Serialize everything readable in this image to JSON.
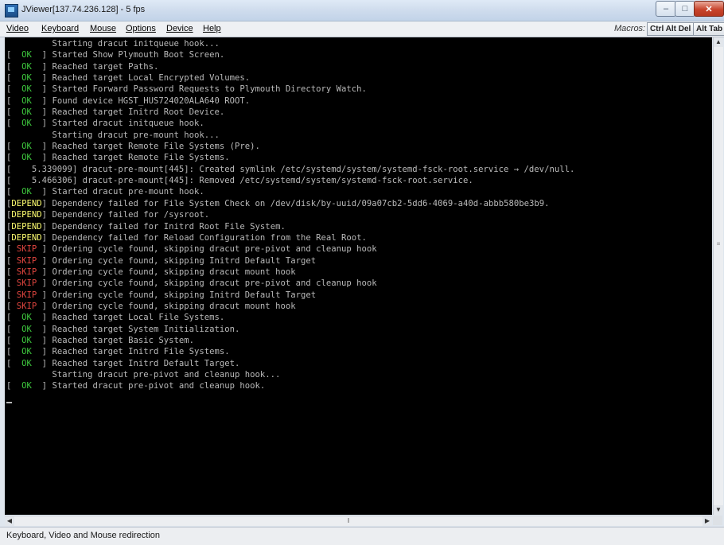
{
  "window": {
    "title": "JViewer[137.74.236.128] - 5 fps",
    "minimize_glyph": "–",
    "maximize_glyph": "□",
    "close_glyph": "✕"
  },
  "menu": {
    "items": [
      "Video",
      "Keyboard",
      "Mouse",
      "Options",
      "Device",
      "Help"
    ]
  },
  "macros": {
    "label": "Macros:",
    "buttons": [
      "Ctrl Alt Del",
      "Alt Tab"
    ]
  },
  "console": {
    "lines": [
      {
        "status": "",
        "text": "         Starting dracut initqueue hook..."
      },
      {
        "status": "ok",
        "text": "Started Show Plymouth Boot Screen."
      },
      {
        "status": "ok",
        "text": "Reached target Paths."
      },
      {
        "status": "ok",
        "text": "Reached target Local Encrypted Volumes."
      },
      {
        "status": "ok",
        "text": "Started Forward Password Requests to Plymouth Directory Watch."
      },
      {
        "status": "ok",
        "text": "Found device HGST_HUS724020ALA640 ROOT."
      },
      {
        "status": "ok",
        "text": "Reached target Initrd Root Device."
      },
      {
        "status": "ok",
        "text": "Started dracut initqueue hook."
      },
      {
        "status": "",
        "text": "         Starting dracut pre-mount hook..."
      },
      {
        "status": "ok",
        "text": "Reached target Remote File Systems (Pre)."
      },
      {
        "status": "ok",
        "text": "Reached target Remote File Systems."
      },
      {
        "status": "",
        "text": "[    5.339099] dracut-pre-mount[445]: Created symlink /etc/systemd/system/systemd-fsck-root.service → /dev/null."
      },
      {
        "status": "",
        "text": "[    5.466306] dracut-pre-mount[445]: Removed /etc/systemd/system/systemd-fsck-root.service."
      },
      {
        "status": "ok",
        "text": "Started dracut pre-mount hook."
      },
      {
        "status": "dep",
        "text": "Dependency failed for File System Check on /dev/disk/by-uuid/09a07cb2-5dd6-4069-a40d-abbb580be3b9."
      },
      {
        "status": "dep",
        "text": "Dependency failed for /sysroot."
      },
      {
        "status": "dep",
        "text": "Dependency failed for Initrd Root File System."
      },
      {
        "status": "dep",
        "text": "Dependency failed for Reload Configuration from the Real Root."
      },
      {
        "status": "skip",
        "text": "Ordering cycle found, skipping dracut pre-pivot and cleanup hook"
      },
      {
        "status": "skip",
        "text": "Ordering cycle found, skipping Initrd Default Target"
      },
      {
        "status": "skip",
        "text": "Ordering cycle found, skipping dracut mount hook"
      },
      {
        "status": "skip",
        "text": "Ordering cycle found, skipping dracut pre-pivot and cleanup hook"
      },
      {
        "status": "skip",
        "text": "Ordering cycle found, skipping Initrd Default Target"
      },
      {
        "status": "skip",
        "text": "Ordering cycle found, skipping dracut mount hook"
      },
      {
        "status": "ok",
        "text": "Reached target Local File Systems."
      },
      {
        "status": "ok",
        "text": "Reached target System Initialization."
      },
      {
        "status": "ok",
        "text": "Reached target Basic System."
      },
      {
        "status": "ok",
        "text": "Reached target Initrd File Systems."
      },
      {
        "status": "ok",
        "text": "Reached target Initrd Default Target."
      },
      {
        "status": "",
        "text": "         Starting dracut pre-pivot and cleanup hook..."
      },
      {
        "status": "ok",
        "text": "Started dracut pre-pivot and cleanup hook."
      }
    ],
    "badges": {
      "ok": "  OK  ",
      "skip": " SKIP ",
      "dep": "DEPEND"
    }
  },
  "status_bar": {
    "text": "Keyboard, Video and Mouse redirection"
  },
  "scrollbar_glyphs": {
    "up": "▲",
    "down": "▼",
    "left": "◀",
    "right": "▶",
    "v_grip": "≡",
    "h_grip": "‖"
  },
  "colors": {
    "ok": "#3ec93e",
    "skip": "#e0453f",
    "depend": "#ffff70",
    "console_bg": "#000000",
    "console_text": "#b9b9b9"
  }
}
